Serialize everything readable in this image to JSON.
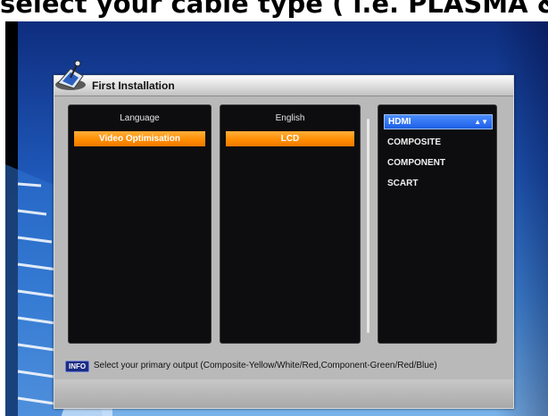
{
  "caption": "select your cable type ( i.e. PLASMA & LCD",
  "dialog": {
    "title": "First Installation"
  },
  "settings_column": {
    "header": "Language",
    "selected_item": "Video Optimisation"
  },
  "value_column": {
    "header": "English",
    "selected_item": "LCD"
  },
  "output_options": {
    "selected": "HDMI",
    "items": [
      "COMPOSITE",
      "COMPONENT",
      "SCART"
    ]
  },
  "info": {
    "key_label": "INFO",
    "text": "Select your primary output (Composite-Yellow/White/Red,Component-Green/Red/Blue)"
  },
  "colors": {
    "highlight_orange": "#ff8b00",
    "highlight_blue": "#1d5fe6",
    "panel_gray": "#b9b9b9",
    "list_bg": "#0d0d0f",
    "screen_blue": "#1e57b8"
  },
  "icons": [
    "satellite-dish-icon",
    "up-down-arrows-icon"
  ]
}
